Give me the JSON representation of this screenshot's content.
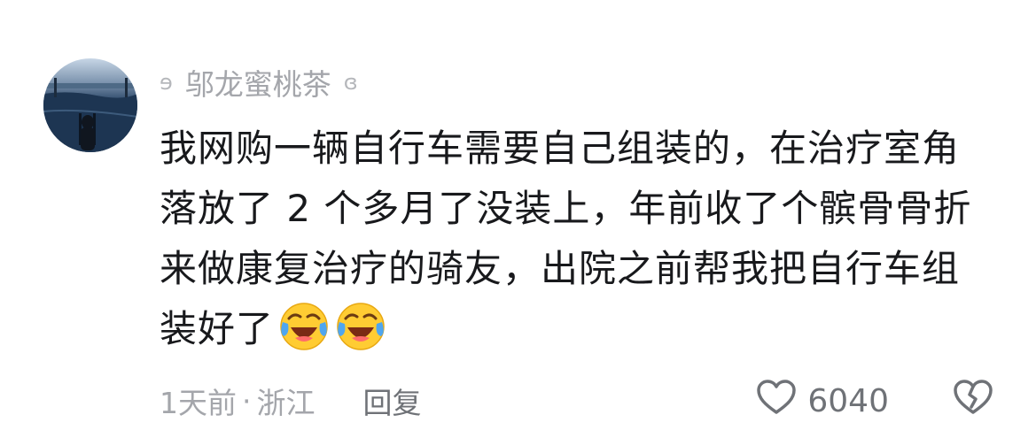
{
  "comment": {
    "username": "邬龙蜜桃茶",
    "text_lines": [
      "我网购一辆自行车需要自己组装的，在治疗室角",
      "落放了 2 个多月了没装上，年前收了个髌骨骨折",
      "来做康复治疗的骑友，出院之前帮我把自行车组",
      "装好了"
    ],
    "emoji": [
      "laugh-cry-emoji",
      "laugh-cry-emoji"
    ],
    "time": "1天前",
    "location_sep": "·",
    "location": "浙江",
    "reply_label": "回复",
    "like_count": "6040",
    "icons": {
      "like": "heart-outline-icon",
      "dislike": "broken-heart-outline-icon"
    }
  }
}
